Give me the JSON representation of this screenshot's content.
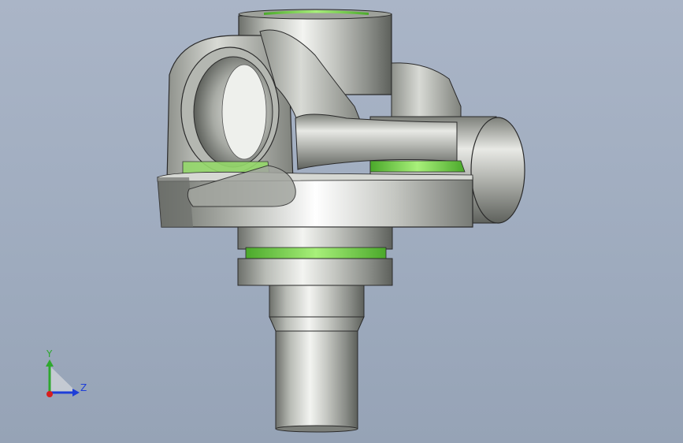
{
  "viewport": {
    "background_top": "#aab5c7",
    "background_bottom": "#96a3b6"
  },
  "part": {
    "body_color": "#c9cbc7",
    "highlight_color": "#f4f5f2",
    "shadow_color": "#5c5f5a",
    "seal_color": "#6fd13a",
    "edge_color": "#1e1e1e"
  },
  "triad": {
    "y_label": "Y",
    "z_label": "Z",
    "y_color": "#2ea82e",
    "z_color": "#1e3ed8",
    "x_color": "#d81e1e"
  }
}
